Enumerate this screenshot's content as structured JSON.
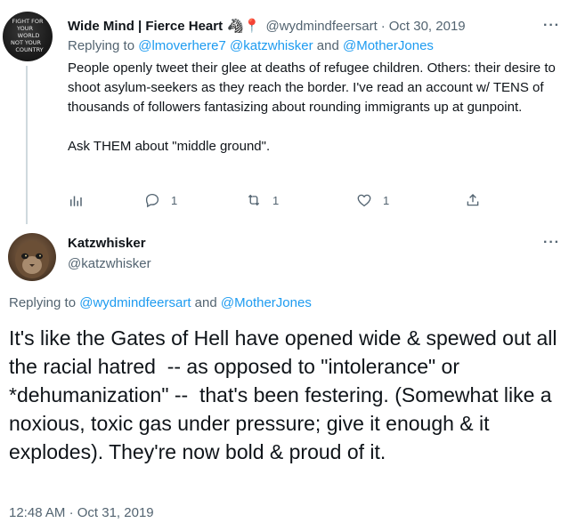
{
  "colors": {
    "text": "#0f1419",
    "secondary": "#536471",
    "link": "#1d9bf0",
    "thread_line": "#cfd9de"
  },
  "tweet1": {
    "avatar_text": "Fight for your world not your country",
    "author_name": "Wide Mind | Fierce Heart",
    "author_emoji": "🦓📍",
    "handle": "@wydmindfeersart",
    "dot": "·",
    "date": "Oct 30, 2019",
    "more": "···",
    "replying_to_prefix": "Replying to",
    "mention_1": "@lmoverhere7",
    "mention_2": "@katzwhisker",
    "replying_and": "and",
    "mention_3": "@MotherJones",
    "body": "People openly tweet their glee at deaths of refugee children. Others: their desire to shoot asylum-seekers as they reach the border. I've read an account w/ TENS of thousands of followers fantasizing about rounding immigrants up at gunpoint.\n\nAsk THEM about \"middle ground\".",
    "actions": {
      "analytics_icon": "analytics-icon",
      "reply_icon": "reply-icon",
      "reply_count": "1",
      "retweet_icon": "retweet-icon",
      "retweet_count": "1",
      "like_icon": "heart-icon",
      "like_count": "1",
      "share_icon": "share-icon"
    }
  },
  "tweet2": {
    "author_name": "Katzwhisker",
    "handle": "@katzwhisker",
    "more": "···",
    "replying_to_prefix": "Replying to",
    "mention_1": "@wydmindfeersart",
    "replying_and": "and",
    "mention_2": "@MotherJones",
    "body": "It's like the Gates of Hell have opened wide & spewed out all the racial hatred  -- as opposed to \"intolerance\" or *dehumanization\" --  that's been festering. (Somewhat like a noxious, toxic gas under pressure; give it enough & it explodes). They're now bold & proud of it.",
    "time": "12:48 AM",
    "dot": "·",
    "date": "Oct 31, 2019"
  }
}
